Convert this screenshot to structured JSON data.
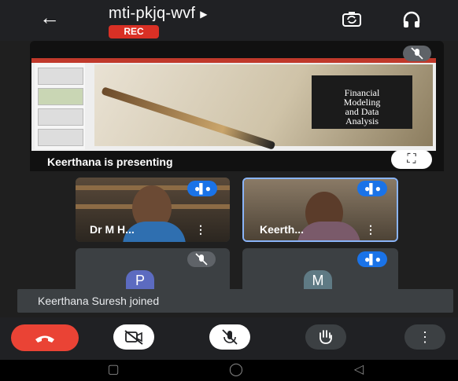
{
  "header": {
    "back_icon": "arrow-left-icon",
    "meeting_code": "mti-pkjq-wvf",
    "expand_icon": "caret-right-icon",
    "rec_badge": "REC",
    "switch_camera_icon": "switch-camera-icon",
    "audio_output_icon": "headphones-icon"
  },
  "presentation": {
    "slide_title_line1": "Financial",
    "slide_title_line2": "Modeling",
    "slide_title_line3": "and Data",
    "slide_title_line4": "Analysis",
    "caption": "Keerthana is presenting",
    "fullscreen_icon": "fullscreen-icon",
    "mic_status_icon": "mic-off-icon"
  },
  "participants": [
    {
      "name": "Dr M H...",
      "menu": "⋮",
      "audio_icon": "speaking-indicator-icon"
    },
    {
      "name": "Keerth...",
      "menu": "⋮",
      "audio_icon": "speaking-indicator-icon"
    },
    {
      "initial": "P",
      "avatar_color": "#5c6bc0",
      "audio_icon": "mic-off-icon"
    },
    {
      "initial": "M",
      "avatar_color": "#5f7a84",
      "audio_icon": "speaking-indicator-icon"
    }
  ],
  "toast": {
    "message": "Keerthana Suresh joined"
  },
  "controls": {
    "end_call_icon": "end-call-icon",
    "camera_icon": "camera-off-icon",
    "mic_icon": "mic-off-icon",
    "raise_hand_icon": "raise-hand-icon",
    "more_icon": "more-vertical-icon"
  },
  "colors": {
    "accent_blue": "#1a73e8",
    "end_call_red": "#ea4335",
    "rec_red": "#d93025"
  }
}
